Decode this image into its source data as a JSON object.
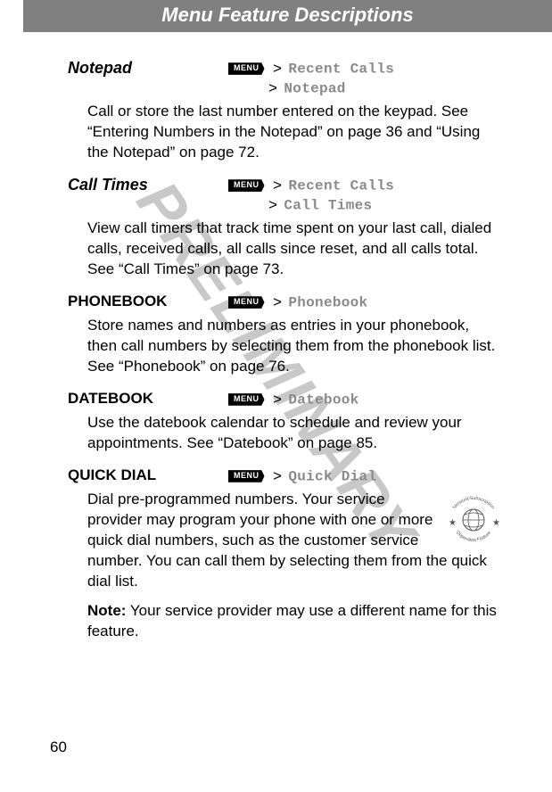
{
  "header": "Menu Feature Descriptions",
  "watermark": "PRELIMINARY",
  "pageNumber": "60",
  "menuKeyLabel": "MENU",
  "gt": ">",
  "sections": [
    {
      "title": "Notepad",
      "titleStyle": "italic",
      "path1": "Recent Calls",
      "path2": "Notepad",
      "body": "Call or store the last number entered on the keypad. See “Entering Numbers in the Notepad” on page 36 and “Using the Notepad” on page 72."
    },
    {
      "title": "Call Times",
      "titleStyle": "italic",
      "path1": "Recent Calls",
      "path2": "Call Times",
      "body": "View call timers that track time spent on your last call, dialed calls, received calls, all calls since reset, and all calls total. See “Call Times” on page 73."
    },
    {
      "title": "PHONEBOOK",
      "titleStyle": "caps",
      "path1": "Phonebook",
      "body": "Store names and numbers as entries in your phonebook, then call numbers by selecting them from the phonebook list. See “Phonebook” on page 76."
    },
    {
      "title": "DATEBOOK",
      "titleStyle": "caps",
      "path1": "Datebook",
      "body": "Use the datebook calendar to schedule and review your appointments. See “Datebook” on page 85."
    },
    {
      "title": "QUICK DIAL",
      "titleStyle": "caps",
      "path1": "Quick Dial",
      "body": "Dial pre-programmed numbers. Your service provider may program your phone with one or more quick dial numbers, such as the customer service number. You can call them by selecting them from the quick dial list.",
      "noteLabel": "Note:",
      "noteBody": " Your service provider may use a different name for this feature.",
      "hasBadge": true
    }
  ],
  "badge": {
    "topText": "Network/Subscription",
    "bottomText": "Dependent Feature"
  }
}
